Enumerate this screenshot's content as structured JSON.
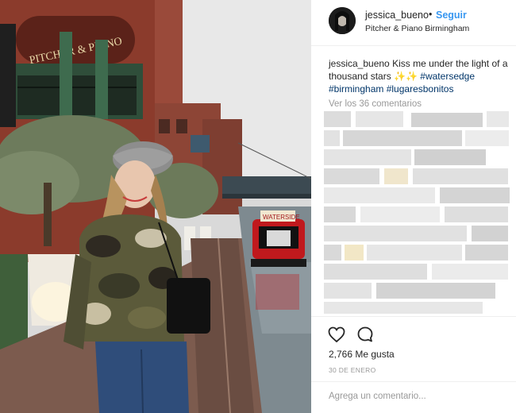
{
  "post": {
    "username": "jessica_bueno",
    "separator": "•",
    "follow_label": "Seguir",
    "location": "Pitcher & Piano Birmingham",
    "photo_sign_text": "PITCHER & PIANO",
    "photo_boat_text": "WATERSIDE"
  },
  "caption": {
    "username": "jessica_bueno",
    "text_before": "Kiss me under the light of a thousand stars",
    "emoji": "✨✨",
    "hashtags": [
      "#watersedge",
      "#birmingham",
      "#lugaresbonitos"
    ]
  },
  "comments": {
    "view_all_label": "Ver los 36 comentarios"
  },
  "actions": {
    "like_icon": "heart-icon",
    "comment_icon": "speech-bubble-icon",
    "likes_text": "2,766 Me gusta",
    "date_text": "30 de enero"
  },
  "comment_input": {
    "placeholder": "Agrega un comentario..."
  },
  "colors": {
    "link_blue": "#3897f0",
    "hashtag": "#003569",
    "muted": "#999999",
    "border": "#efefef"
  }
}
